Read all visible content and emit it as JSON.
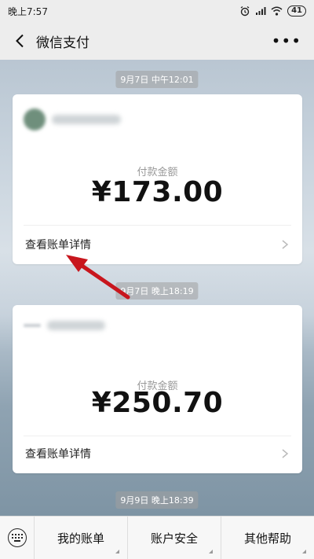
{
  "status_bar": {
    "time": "晚上7:57",
    "battery": "41"
  },
  "header": {
    "title": "微信支付"
  },
  "messages": [
    {
      "time": "9月7日 中午12:01",
      "pay_label": "付款金额",
      "amount": "¥173.00",
      "detail_link": "查看账单详情"
    },
    {
      "time": "9月7日 晚上18:19",
      "pay_label": "付款金额",
      "amount": "¥250.70",
      "detail_link": "查看账单详情"
    }
  ],
  "footer_time": "9月9日 晚上18:39",
  "bottom_menu": {
    "tabs": [
      "我的账单",
      "账户安全",
      "其他帮助"
    ]
  },
  "colors": {
    "annotation_arrow": "#c8161d",
    "bar_bg": "#ededed"
  },
  "icons": [
    "back-arrow-icon",
    "more-dots-icon",
    "chevron-right-icon",
    "keyboard-icon"
  ]
}
